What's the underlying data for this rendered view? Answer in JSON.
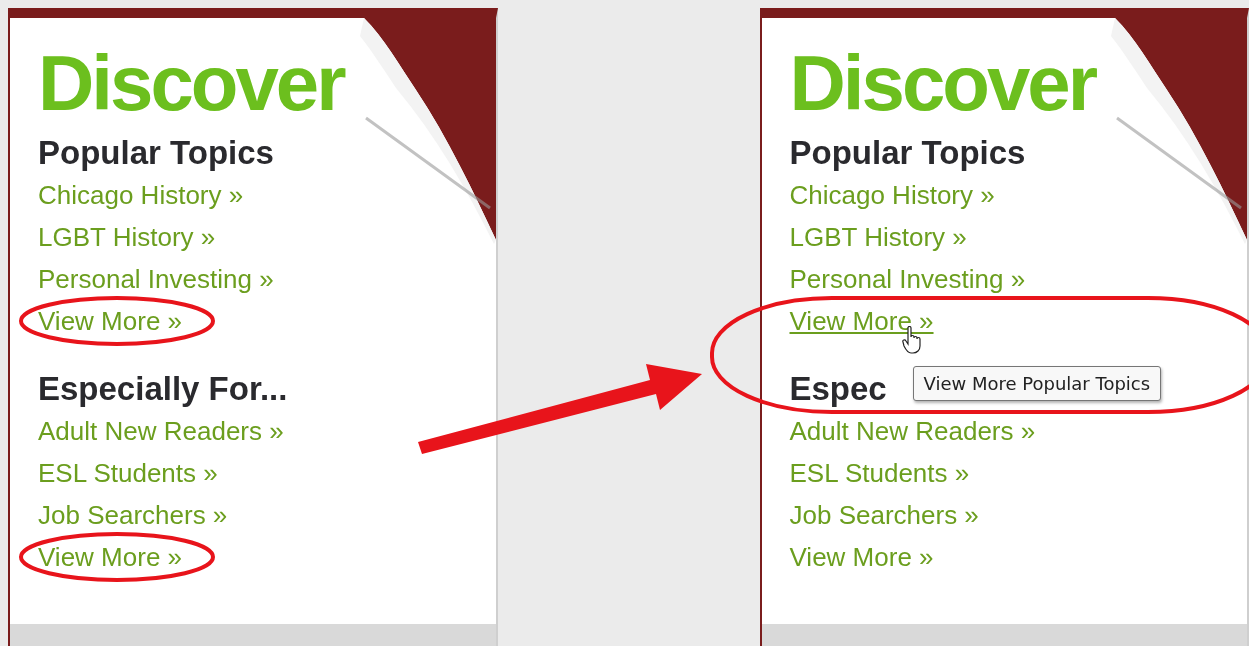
{
  "panels": [
    {
      "logo": "Discover",
      "sections": [
        {
          "heading": "Popular Topics",
          "links": [
            {
              "label": "Chicago History »",
              "hovered": false,
              "circled": false
            },
            {
              "label": "LGBT History »",
              "hovered": false,
              "circled": false
            },
            {
              "label": "Personal Investing »",
              "hovered": false,
              "circled": false
            },
            {
              "label": "View More »",
              "hovered": false,
              "circled": true
            }
          ]
        },
        {
          "heading": "Especially For...",
          "links": [
            {
              "label": "Adult New Readers »",
              "hovered": false,
              "circled": false
            },
            {
              "label": "ESL Students »",
              "hovered": false,
              "circled": false
            },
            {
              "label": "Job Searchers »",
              "hovered": false,
              "circled": false
            },
            {
              "label": "View More »",
              "hovered": false,
              "circled": true
            }
          ]
        }
      ]
    },
    {
      "logo": "Discover",
      "sections": [
        {
          "heading": "Popular Topics",
          "links": [
            {
              "label": "Chicago History »",
              "hovered": false,
              "circled": false
            },
            {
              "label": "LGBT History »",
              "hovered": false,
              "circled": false
            },
            {
              "label": "Personal Investing »",
              "hovered": false,
              "circled": false
            },
            {
              "label": "View More »",
              "hovered": true,
              "circled": true,
              "tooltip": "View More Popular Topics"
            }
          ]
        },
        {
          "heading": "Espec",
          "links": [
            {
              "label": "Adult New Readers »",
              "hovered": false,
              "circled": false
            },
            {
              "label": "ESL Students »",
              "hovered": false,
              "circled": false
            },
            {
              "label": "Job Searchers »",
              "hovered": false,
              "circled": false
            },
            {
              "label": "View More »",
              "hovered": false,
              "circled": false
            }
          ]
        }
      ]
    }
  ]
}
